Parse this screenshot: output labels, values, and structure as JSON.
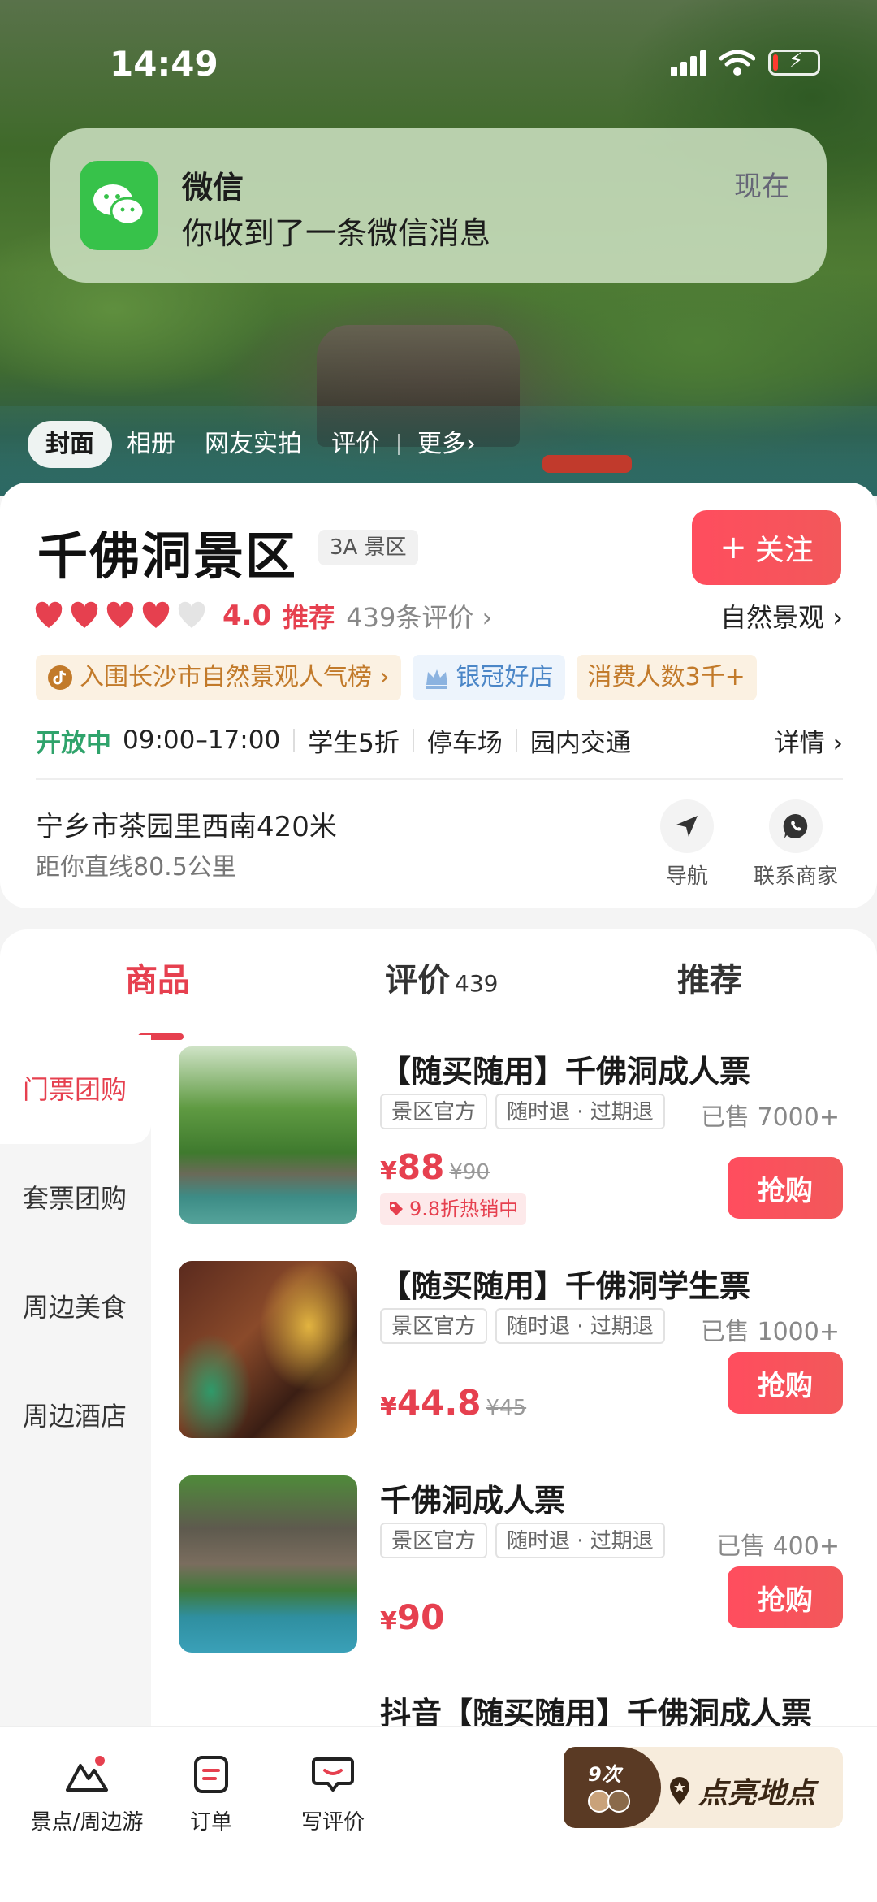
{
  "status_bar": {
    "time": "14:49"
  },
  "notification": {
    "app": "微信",
    "message": "你收到了一条微信消息",
    "time": "现在"
  },
  "hero_tabs": [
    {
      "label": "封面",
      "active": true
    },
    {
      "label": "相册"
    },
    {
      "label": "网友实拍"
    },
    {
      "label": "评价"
    },
    {
      "label": "更多›"
    }
  ],
  "poi": {
    "title": "千佛洞景区",
    "badge": "3A 景区",
    "follow_label": "关注",
    "rating": {
      "score": "4.0",
      "hearts_filled": 4,
      "hearts_total": 5,
      "recommend": "推荐",
      "review_count": "439条评价 ›"
    },
    "category": "自然景观 ›",
    "tags": {
      "rank": "入围长沙市自然景观人气榜 ›",
      "crown": "银冠好店",
      "count": "消费人数3千+"
    },
    "hours": {
      "status": "开放中",
      "time": "09:00–17:00",
      "features": [
        "学生5折",
        "停车场",
        "园内交通"
      ],
      "details": "详情 ›"
    },
    "address": "宁乡市茶园里西南420米",
    "distance": "距你直线80.5公里",
    "actions": {
      "navigate": "导航",
      "contact": "联系商家"
    }
  },
  "main_tabs": {
    "goods": "商品",
    "reviews": "评价",
    "reviews_count": "439",
    "recommend": "推荐"
  },
  "side_nav": [
    {
      "label": "门票团购",
      "active": true
    },
    {
      "label": "套票团购"
    },
    {
      "label": "周边美食"
    },
    {
      "label": "周边酒店"
    }
  ],
  "products": [
    {
      "title": "【随买随用】千佛洞成人票",
      "tags": [
        "景区官方",
        "随时退 · 过期退"
      ],
      "sold": "已售 7000+",
      "price": "88",
      "original": "¥90",
      "promo": "9.8折热销中",
      "buy": "抢购"
    },
    {
      "title": "【随买随用】千佛洞学生票",
      "tags": [
        "景区官方",
        "随时退 · 过期退"
      ],
      "sold": "已售 1000+",
      "price": "44.8",
      "original": "¥45",
      "buy": "抢购"
    },
    {
      "title": "千佛洞成人票",
      "tags": [
        "景区官方",
        "随时退 · 过期退"
      ],
      "sold": "已售 400+",
      "price": "90",
      "buy": "抢购"
    },
    {
      "title": "抖音【随买随用】千佛洞成人票"
    }
  ],
  "price_symbol": "¥",
  "bottom_bar": {
    "nearby": "景点/周边游",
    "orders": "订单",
    "write_review": "写评价",
    "checkin_count": "9次",
    "checkin_label": "点亮地点"
  },
  "colors": {
    "accent": "#e6404f",
    "open_green": "#2fa36b",
    "wechat_green": "#37c24a"
  }
}
